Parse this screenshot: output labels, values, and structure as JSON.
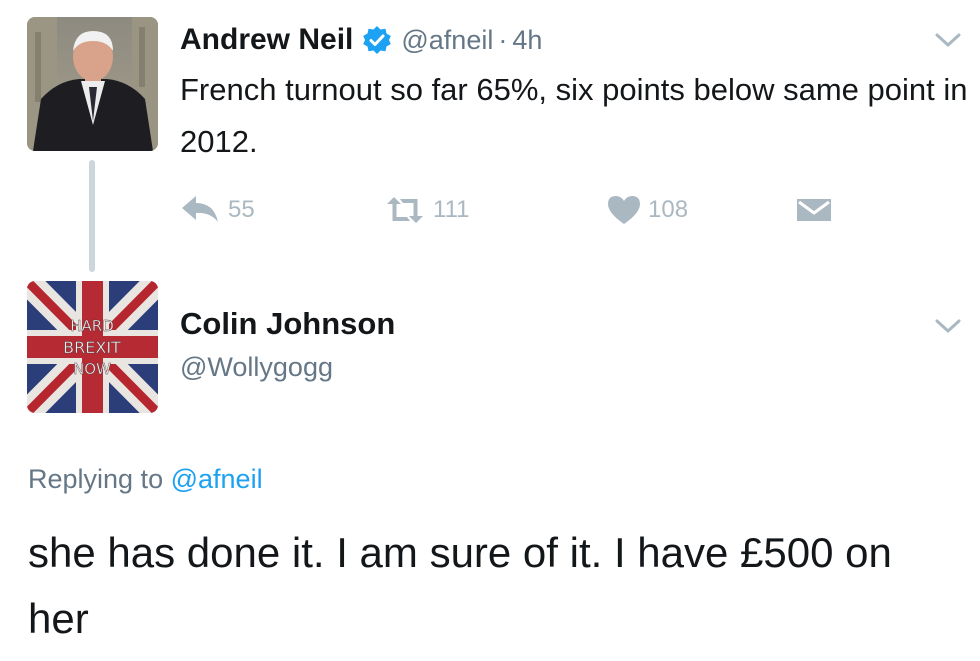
{
  "tweet1": {
    "author_name": "Andrew Neil",
    "handle": "@afneil",
    "separator": "·",
    "time": "4h",
    "text": "French turnout so far 65%, six points below same point in 2012.",
    "actions": {
      "reply_count": "55",
      "retweet_count": "111",
      "like_count": "108"
    },
    "avatar_icon": "profile-photo-man-in-suit",
    "verified_icon": "verified-badge-icon"
  },
  "tweet2": {
    "author_name": "Colin Johnson",
    "handle": "@Wollygogg",
    "avatar": {
      "line1": "HARD",
      "line2": "BREXIT",
      "line3": "NOW"
    },
    "replying_prefix": "Replying to",
    "replying_to": "@afneil",
    "text": "she has done it. I am sure of it. I have £500 on her"
  },
  "colors": {
    "text": "#14171a",
    "secondary": "#657786",
    "action_gray": "#aab8c2",
    "link_blue": "#1da1f2",
    "verified_blue": "#1da1f2",
    "thread_line": "#ccd6dd"
  }
}
